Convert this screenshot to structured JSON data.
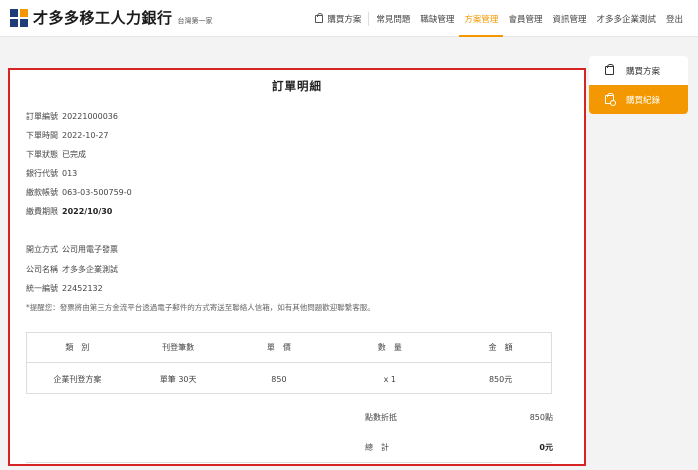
{
  "header": {
    "brand": "才多多移工人力銀行",
    "tagline": "台灣第一家",
    "nav": [
      {
        "label": "購買方案"
      },
      {
        "label": "常見問題"
      },
      {
        "label": "職缺管理"
      },
      {
        "label": "方案管理",
        "active": true
      },
      {
        "label": "會員管理"
      },
      {
        "label": "資訊管理"
      },
      {
        "label": "才多多企業測試"
      },
      {
        "label": "登出"
      }
    ]
  },
  "order": {
    "title": "訂單明細",
    "number_label": "訂單編號",
    "number": "20221000036",
    "date_label": "下單時間",
    "date": "2022-10-27",
    "status_label": "下單狀態",
    "status": "已完成",
    "bank_label": "銀行代號",
    "bank": "013",
    "account_label": "繳款帳號",
    "account": "063-03-500759-0",
    "deadline_label": "繳費期限",
    "deadline": "2022/10/30",
    "invoice_label": "開立方式",
    "invoice": "公司用電子發票",
    "company_label": "公司名稱",
    "company": "才多多企業測試",
    "taxid_label": "統一編號",
    "taxid": "22452132",
    "notice": "*提醒您：發票將由第三方金流平台透過電子郵件的方式寄送至聯絡人信箱，如有其他問題歡迎聯繫客服。"
  },
  "table": {
    "headers": [
      "類　別",
      "刊登筆數",
      "單　價",
      "數　量",
      "金　額"
    ],
    "row": [
      "企業刊登方案",
      "單筆 30天",
      "850",
      "x 1",
      "850元"
    ]
  },
  "summary": {
    "discount_label": "點數折抵",
    "discount": "850點",
    "total_label": "總　計",
    "total": "0元"
  },
  "sidebar": {
    "items": [
      {
        "label": "購買方案"
      },
      {
        "label": "購買紀錄",
        "active": true
      }
    ]
  },
  "colors": {
    "accent": "#f39800",
    "highlight_border": "#d62424",
    "brand_navy": "#1f3c78"
  }
}
